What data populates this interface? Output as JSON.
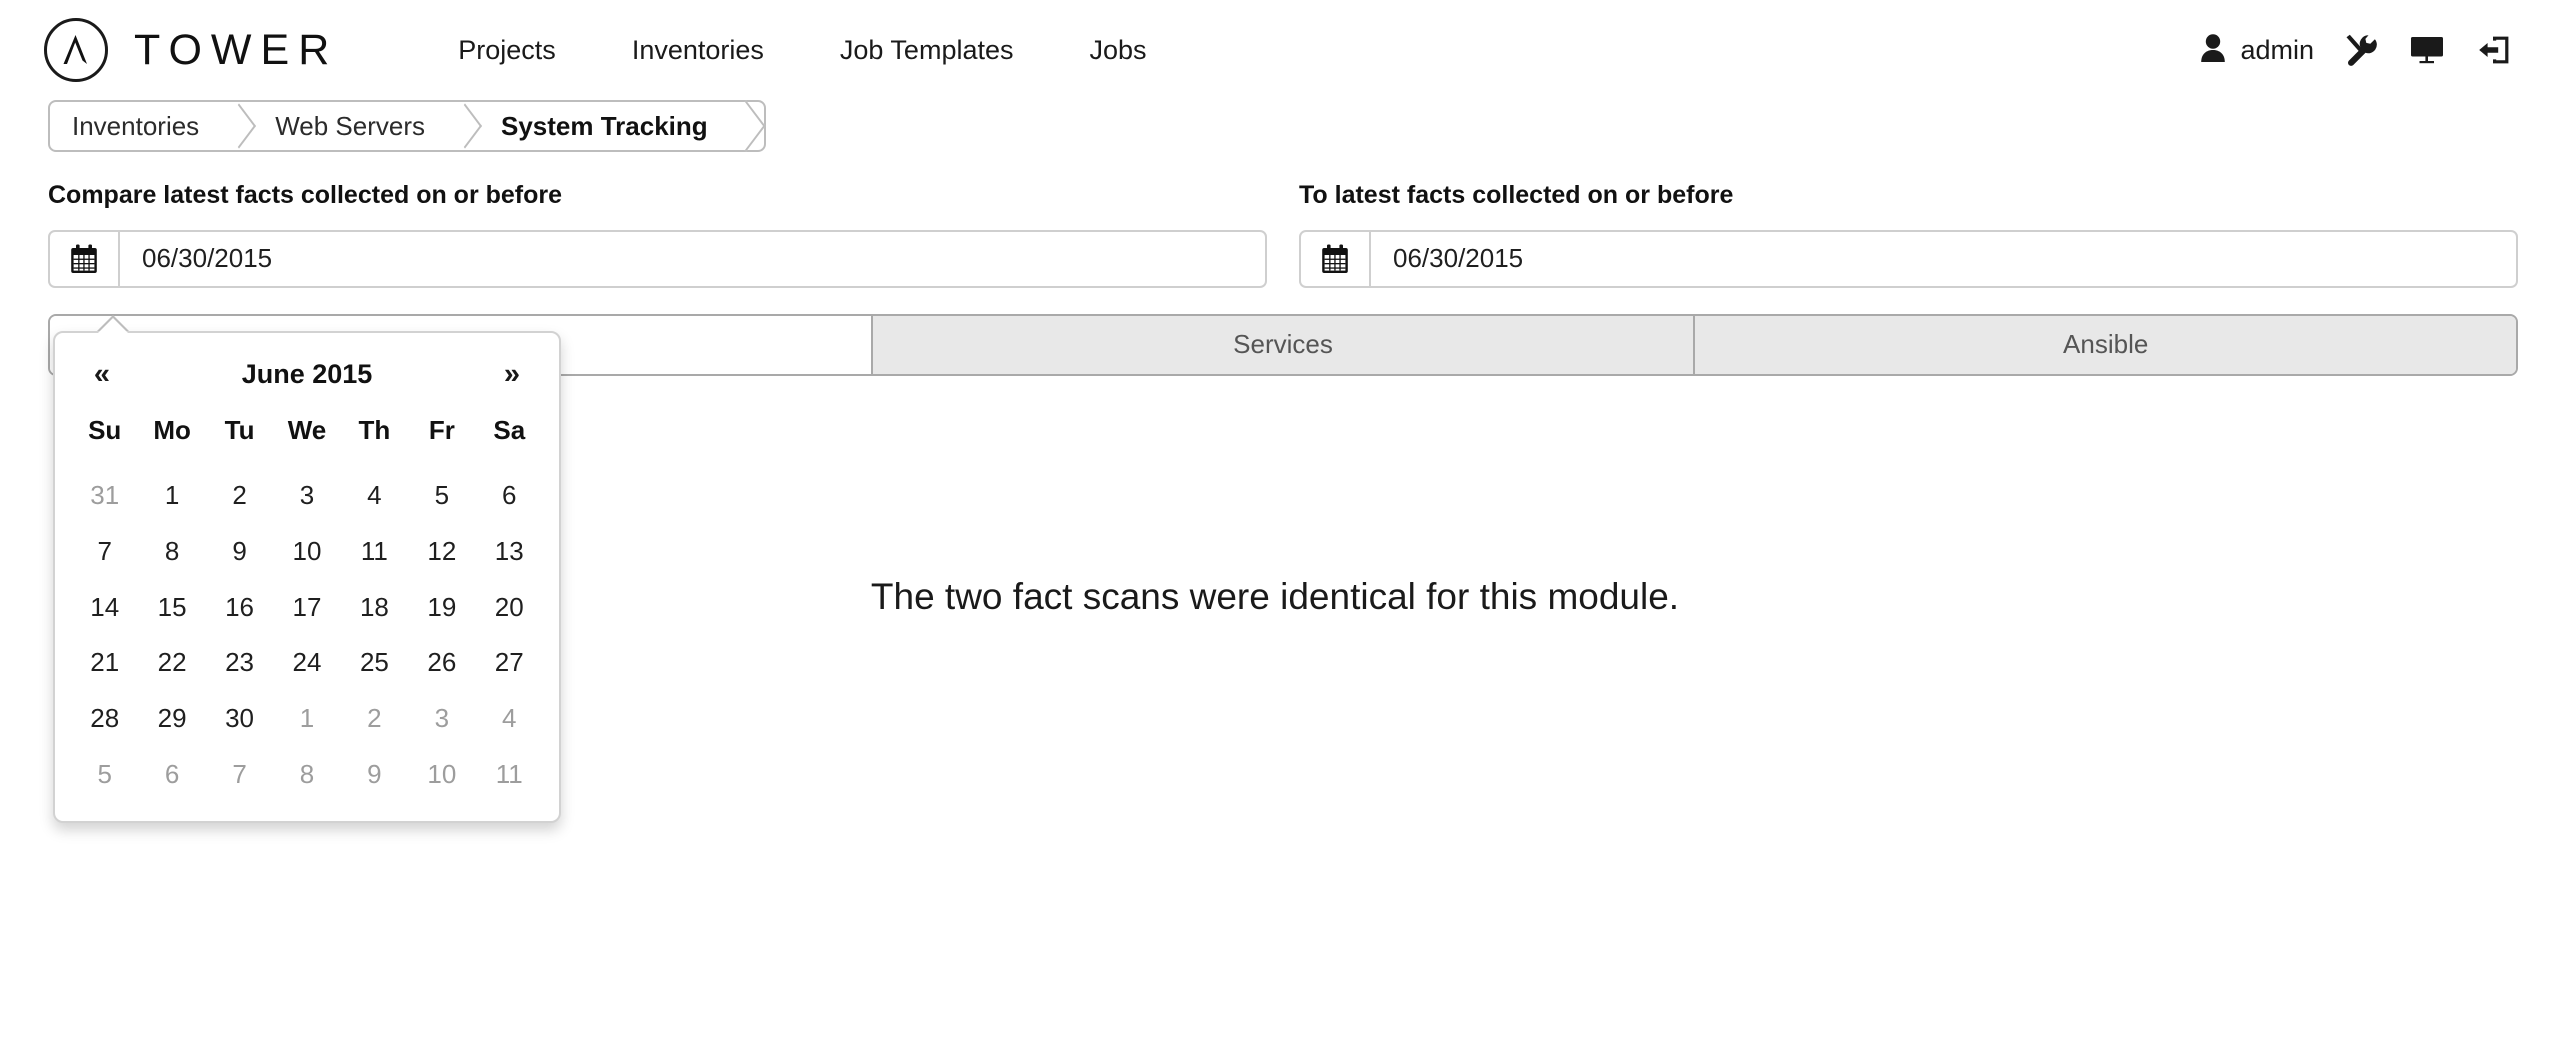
{
  "brand": {
    "name": "TOWER",
    "logo_icon": "ansible-a-logo-icon"
  },
  "nav": {
    "items": [
      {
        "label": "Projects"
      },
      {
        "label": "Inventories"
      },
      {
        "label": "Job Templates"
      },
      {
        "label": "Jobs"
      }
    ]
  },
  "user_nav": {
    "user_icon": "user-icon",
    "username": "admin",
    "tools_icon": "wrench-screwdriver-icon",
    "screen_icon": "monitor-icon",
    "logout_icon": "logout-icon"
  },
  "breadcrumb": {
    "items": [
      {
        "label": "Inventories",
        "active": false
      },
      {
        "label": "Web Servers",
        "active": false
      },
      {
        "label": "System Tracking",
        "active": true
      }
    ]
  },
  "filters": {
    "left": {
      "label": "Compare latest facts collected on or before",
      "value": "06/30/2015",
      "placeholder": "MM/DD/YYYY",
      "calendar_icon": "calendar-icon"
    },
    "right": {
      "label": "To latest facts collected on or before",
      "value": "06/30/2015",
      "placeholder": "MM/DD/YYYY",
      "calendar_icon": "calendar-icon"
    }
  },
  "tabs": [
    {
      "label": "",
      "active": true
    },
    {
      "label": "Services",
      "active": false
    },
    {
      "label": "Ansible",
      "active": false
    }
  ],
  "main": {
    "message": "The two fact scans were identical for this module."
  },
  "datepicker": {
    "prev_label": "«",
    "next_label": "»",
    "title": "June 2015",
    "weekdays": [
      "Su",
      "Mo",
      "Tu",
      "We",
      "Th",
      "Fr",
      "Sa"
    ],
    "weeks": [
      [
        {
          "day": "31",
          "muted": true
        },
        {
          "day": "1",
          "muted": false
        },
        {
          "day": "2",
          "muted": false
        },
        {
          "day": "3",
          "muted": false
        },
        {
          "day": "4",
          "muted": false
        },
        {
          "day": "5",
          "muted": false
        },
        {
          "day": "6",
          "muted": false
        }
      ],
      [
        {
          "day": "7",
          "muted": false
        },
        {
          "day": "8",
          "muted": false
        },
        {
          "day": "9",
          "muted": false
        },
        {
          "day": "10",
          "muted": false
        },
        {
          "day": "11",
          "muted": false
        },
        {
          "day": "12",
          "muted": false
        },
        {
          "day": "13",
          "muted": false
        }
      ],
      [
        {
          "day": "14",
          "muted": false
        },
        {
          "day": "15",
          "muted": false
        },
        {
          "day": "16",
          "muted": false
        },
        {
          "day": "17",
          "muted": false
        },
        {
          "day": "18",
          "muted": false
        },
        {
          "day": "19",
          "muted": false
        },
        {
          "day": "20",
          "muted": false
        }
      ],
      [
        {
          "day": "21",
          "muted": false
        },
        {
          "day": "22",
          "muted": false
        },
        {
          "day": "23",
          "muted": false
        },
        {
          "day": "24",
          "muted": false
        },
        {
          "day": "25",
          "muted": false
        },
        {
          "day": "26",
          "muted": false
        },
        {
          "day": "27",
          "muted": false
        }
      ],
      [
        {
          "day": "28",
          "muted": false
        },
        {
          "day": "29",
          "muted": false
        },
        {
          "day": "30",
          "muted": false
        },
        {
          "day": "1",
          "muted": true
        },
        {
          "day": "2",
          "muted": true
        },
        {
          "day": "3",
          "muted": true
        },
        {
          "day": "4",
          "muted": true
        }
      ],
      [
        {
          "day": "5",
          "muted": true
        },
        {
          "day": "6",
          "muted": true
        },
        {
          "day": "7",
          "muted": true
        },
        {
          "day": "8",
          "muted": true
        },
        {
          "day": "9",
          "muted": true
        },
        {
          "day": "10",
          "muted": true
        },
        {
          "day": "11",
          "muted": true
        }
      ]
    ]
  },
  "colors": {
    "tab_inactive_bg": "#e8e8e8",
    "border": "#bdbdbd",
    "text": "#1a1a1a",
    "muted_text": "#9d9d9d"
  }
}
